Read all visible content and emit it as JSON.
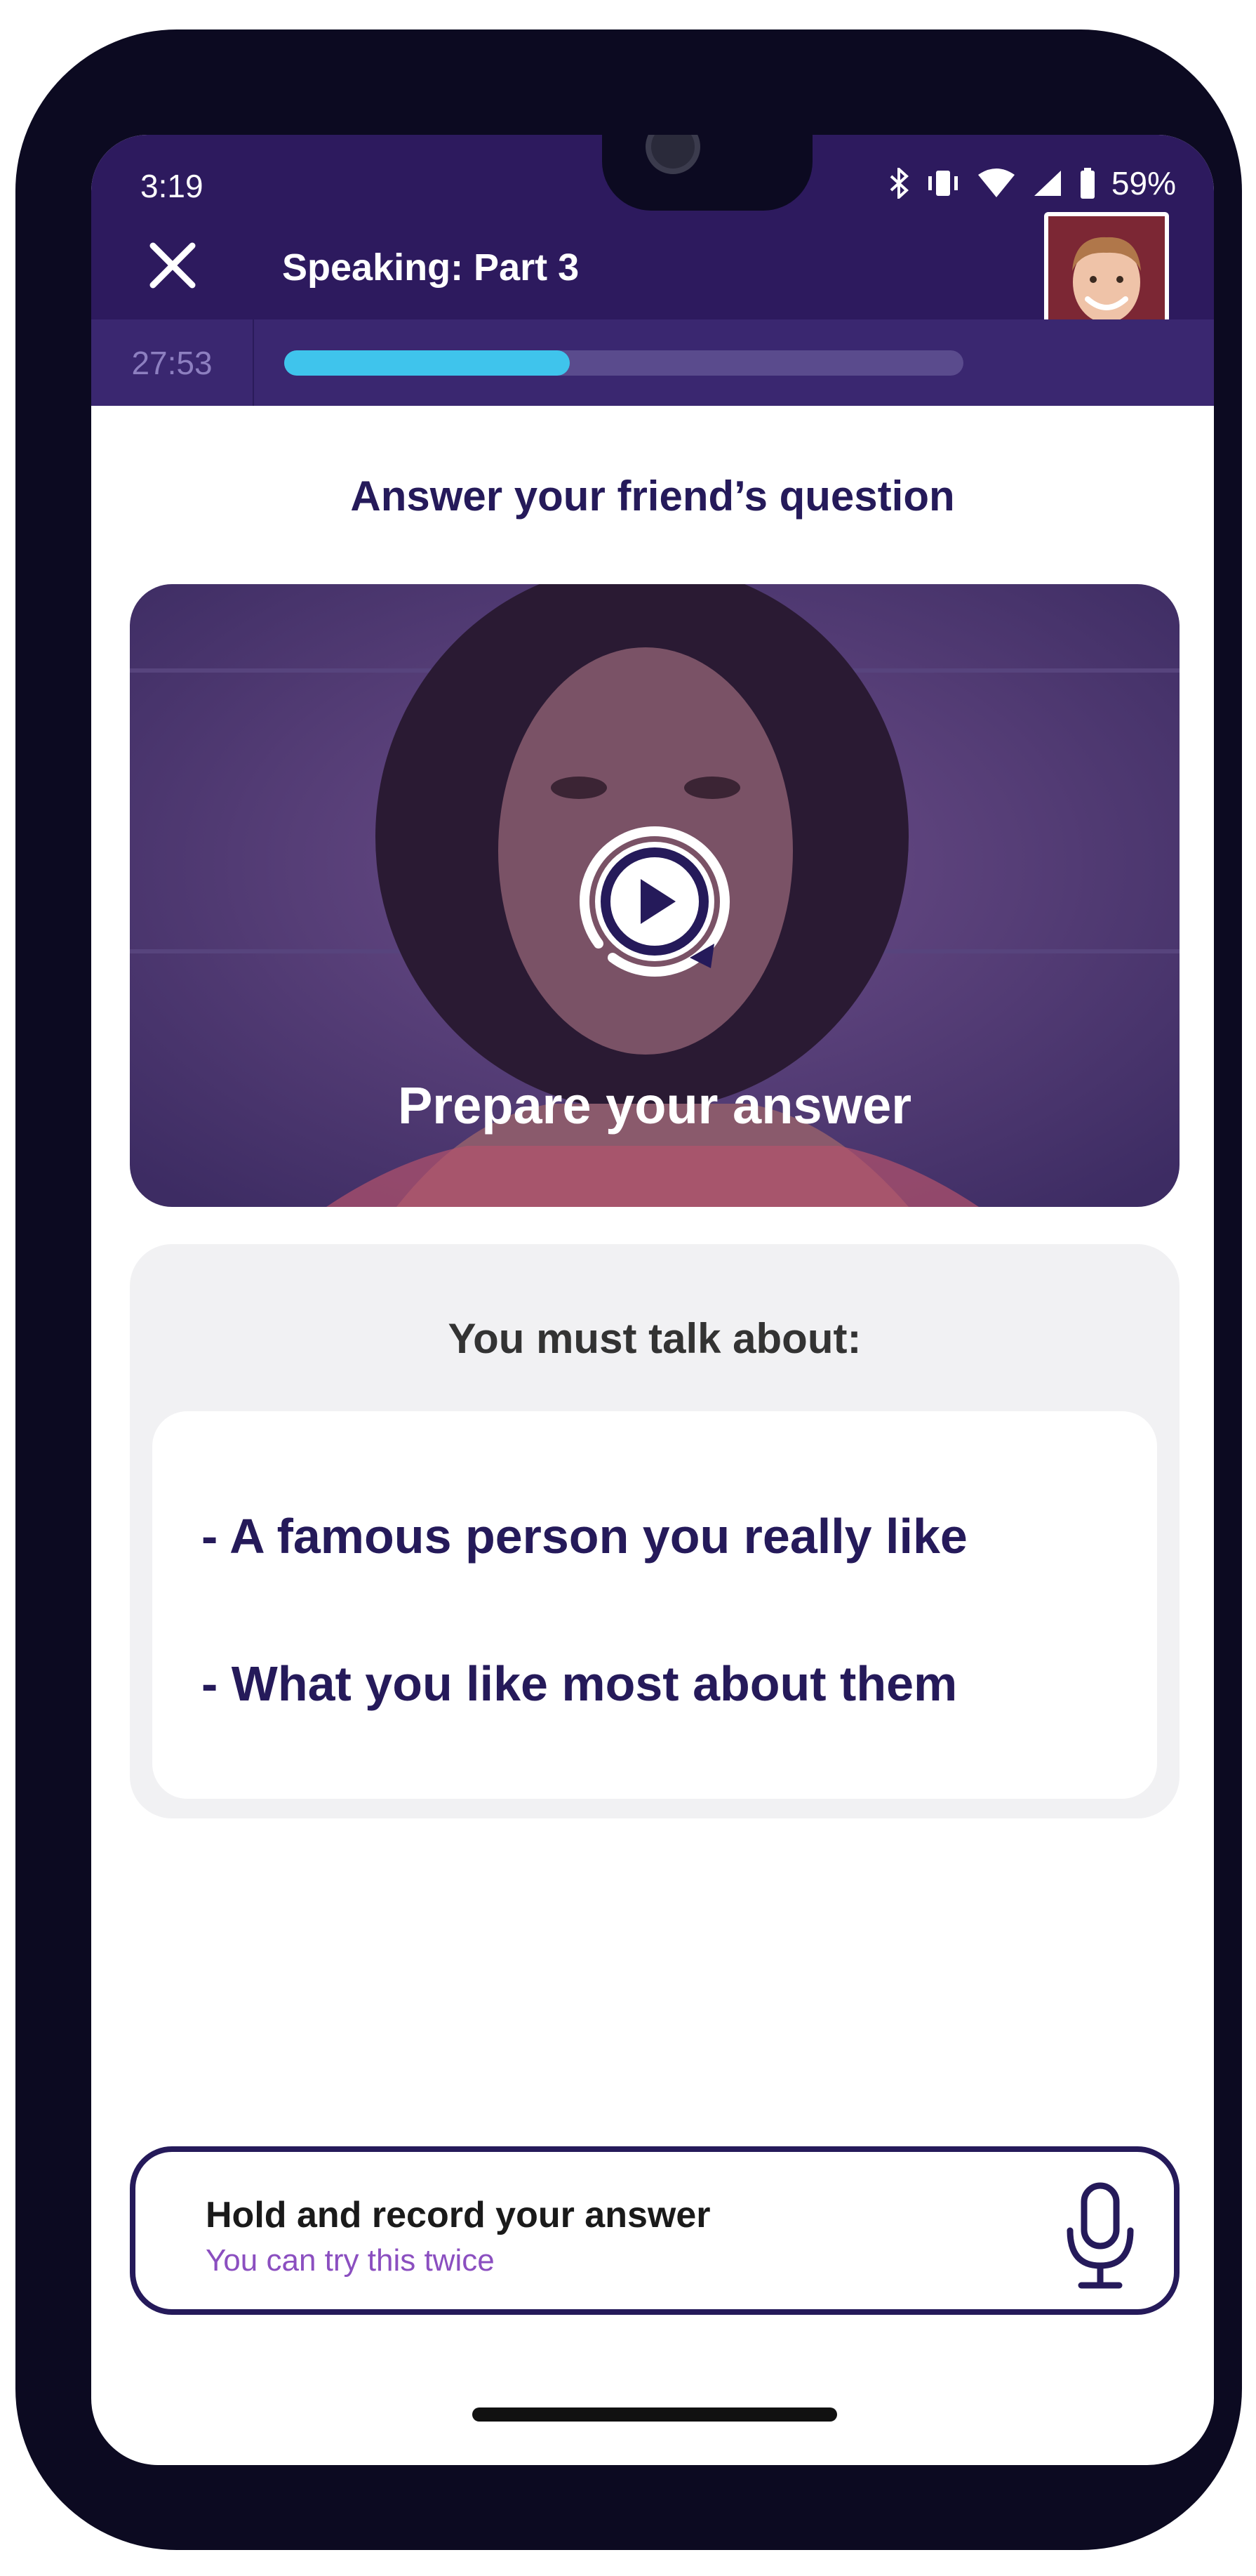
{
  "status_bar": {
    "time": "3:19",
    "battery": "59%"
  },
  "header": {
    "title": "Speaking: Part 3",
    "close_icon": "close-icon"
  },
  "progress": {
    "timer": "27:53",
    "fraction": 0.42
  },
  "main": {
    "heading": "Answer your friend’s question",
    "video": {
      "label": "Prepare your answer",
      "play_icon": "replay-play-icon"
    },
    "topics": {
      "heading": "You must talk about:",
      "items": [
        "-  A famous person you really like",
        "-  What you like most about them"
      ]
    }
  },
  "record": {
    "title": "Hold and record your answer",
    "subtitle": "You can try this twice",
    "icon": "microphone-icon"
  },
  "colors": {
    "header_bg": "#2d1a5e",
    "progress_fill": "#3fc4ec",
    "text_dark": "#251a5a",
    "subtitle": "#8b4fc0"
  }
}
